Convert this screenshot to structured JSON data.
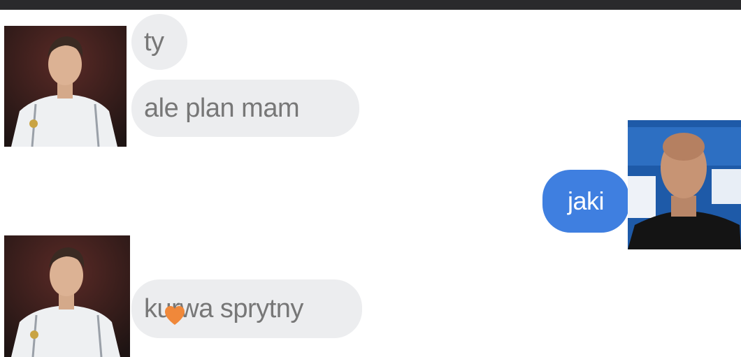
{
  "conversation": {
    "messages": [
      {
        "sender": "contact",
        "text": "ty"
      },
      {
        "sender": "contact",
        "text": "ale plan mam"
      },
      {
        "sender": "self",
        "text": "jaki"
      },
      {
        "sender": "contact",
        "text": "kurwa sprytny"
      }
    ]
  },
  "icons": {
    "reaction": "heart-icon"
  },
  "colors": {
    "incoming_bubble": "#ecedef",
    "incoming_text": "#777777",
    "outgoing_bubble": "#3f7fe0",
    "outgoing_text": "#ffffff",
    "reaction": "#f0883a",
    "top_bar": "#2a2a2c"
  }
}
